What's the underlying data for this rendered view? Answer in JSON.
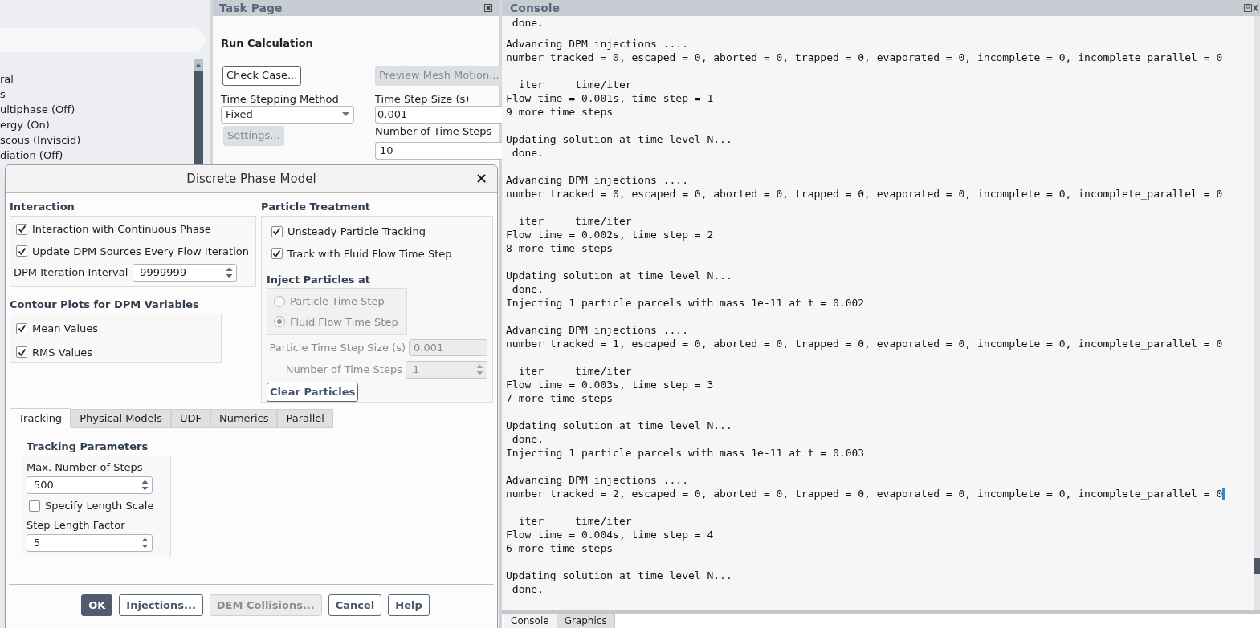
{
  "left_panel": {
    "tree_items": [
      "ral",
      "s",
      "ultiphase (Off)",
      "ergy (On)",
      "scous (Inviscid)",
      "diation (Off)"
    ]
  },
  "task_page": {
    "title": "Task Page",
    "heading": "Run Calculation",
    "check_case_button": "Check Case...",
    "preview_button": {
      "label": "Preview Mesh Motion...",
      "disabled": true
    },
    "time_stepping_method": {
      "label": "Time Stepping Method",
      "value": "Fixed"
    },
    "settings_button": {
      "label": "Settings...",
      "disabled": true
    },
    "time_step_size": {
      "label": "Time Step Size (s)",
      "value": "0.001"
    },
    "number_of_time_steps": {
      "label": "Number of Time Steps",
      "value": "10"
    }
  },
  "console": {
    "title": "Console",
    "paragraphs": [
      [
        " done."
      ],
      [
        "Advancing DPM injections ....",
        "number tracked = 0, escaped = 0, aborted = 0, trapped = 0, evaporated = 0, incomplete = 0, incomplete_parallel = 0"
      ],
      [
        "  iter     time/iter",
        "Flow time = 0.001s, time step = 1",
        "9 more time steps"
      ],
      [
        "Updating solution at time level N...",
        " done."
      ],
      [
        "Advancing DPM injections ....",
        "number tracked = 0, escaped = 0, aborted = 0, trapped = 0, evaporated = 0, incomplete = 0, incomplete_parallel = 0"
      ],
      [
        "  iter     time/iter",
        "Flow time = 0.002s, time step = 2",
        "8 more time steps"
      ],
      [
        "Updating solution at time level N...",
        " done.",
        "Injecting 1 particle parcels with mass 1e-11 at t = 0.002"
      ],
      [
        "Advancing DPM injections ....",
        "number tracked = 1, escaped = 0, aborted = 0, trapped = 0, evaporated = 0, incomplete = 0, incomplete_parallel = 0"
      ],
      [
        "  iter     time/iter",
        "Flow time = 0.003s, time step = 3",
        "7 more time steps"
      ],
      [
        "Updating solution at time level N...",
        " done.",
        "Injecting 1 particle parcels with mass 1e-11 at t = 0.003"
      ],
      [
        "Advancing DPM injections ....",
        "number tracked = 2, escaped = 0, aborted = 0, trapped = 0, evaporated = 0, incomplete = 0, incomplete_parallel = 0"
      ],
      [
        "  iter     time/iter",
        "Flow time = 0.004s, time step = 4",
        "6 more time steps"
      ],
      [
        "Updating solution at time level N...",
        " done."
      ]
    ],
    "tabs": [
      {
        "label": "Console",
        "selected": true
      },
      {
        "label": "Graphics",
        "selected": false
      }
    ]
  },
  "dialog": {
    "title": "Discrete Phase Model",
    "close_button": "×",
    "interaction": {
      "title": "Interaction",
      "options": [
        {
          "label": "Interaction with Continuous Phase",
          "checked": true
        },
        {
          "label": "Update DPM Sources Every Flow Iteration",
          "checked": true
        }
      ],
      "iteration_interval": {
        "label": "DPM Iteration Interval",
        "value": "9999999"
      }
    },
    "contour_plots": {
      "title": "Contour Plots for DPM Variables",
      "options": [
        {
          "label": "Mean Values",
          "checked": true
        },
        {
          "label": "RMS Values",
          "checked": true
        }
      ]
    },
    "particle_treatment": {
      "title": "Particle Treatment",
      "options": [
        {
          "label": "Unsteady Particle Tracking",
          "checked": true
        },
        {
          "label": "Track with Fluid Flow Time Step",
          "checked": true
        }
      ],
      "inject_at": {
        "title": "Inject Particles at",
        "disabled": true,
        "options": [
          {
            "label": "Particle Time Step",
            "selected": false
          },
          {
            "label": "Fluid Flow Time Step",
            "selected": true
          }
        ]
      },
      "time_step_size": {
        "label": "Particle Time Step Size (s)",
        "value": "0.001",
        "disabled": true
      },
      "number_of_time_steps": {
        "label": "Number of Time Steps",
        "value": "1",
        "disabled": true
      },
      "clear_button": "Clear Particles"
    },
    "tabs": [
      {
        "label": "Tracking",
        "selected": true
      },
      {
        "label": "Physical Models",
        "selected": false
      },
      {
        "label": "UDF",
        "selected": false
      },
      {
        "label": "Numerics",
        "selected": false
      },
      {
        "label": "Parallel",
        "selected": false
      }
    ],
    "tracking_parameters": {
      "title": "Tracking Parameters",
      "max_steps": {
        "label": "Max. Number of Steps",
        "value": "500"
      },
      "specify_length_scale": {
        "label": "Specify Length Scale",
        "checked": false
      },
      "step_length_factor": {
        "label": "Step Length Factor",
        "value": "5"
      }
    },
    "buttons": [
      {
        "label": "OK",
        "kind": "primary"
      },
      {
        "label": "Injections...",
        "kind": "normal"
      },
      {
        "label": "DEM Collisions...",
        "kind": "disabled"
      },
      {
        "label": "Cancel",
        "kind": "normal"
      },
      {
        "label": "Help",
        "kind": "normal"
      }
    ]
  }
}
